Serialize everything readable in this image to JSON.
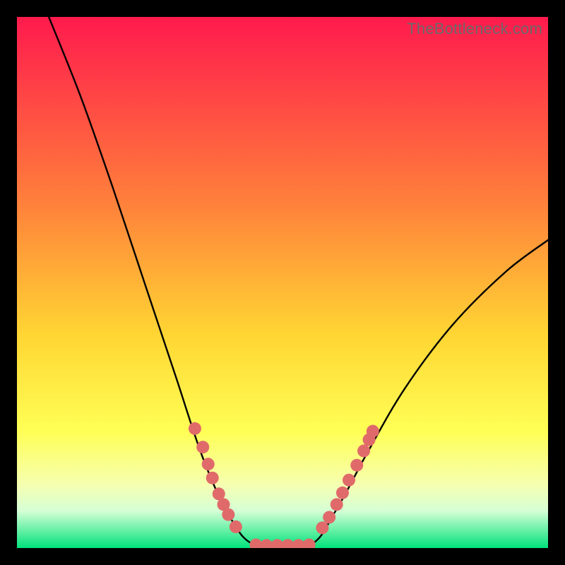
{
  "watermark": "TheBottleneck.com",
  "chart_data": {
    "type": "line",
    "title": "",
    "xlabel": "",
    "ylabel": "",
    "xlim": [
      0,
      100
    ],
    "ylim": [
      0,
      100
    ],
    "gradient_stops": [
      {
        "offset": 0,
        "color": "#ff1a4d"
      },
      {
        "offset": 35,
        "color": "#ff803b"
      },
      {
        "offset": 60,
        "color": "#ffd633"
      },
      {
        "offset": 78,
        "color": "#ffff55"
      },
      {
        "offset": 88,
        "color": "#f6ffb0"
      },
      {
        "offset": 93,
        "color": "#d6ffd6"
      },
      {
        "offset": 100,
        "color": "#00e27a"
      }
    ],
    "curve_left": [
      {
        "x": 6,
        "y": 100
      },
      {
        "x": 12,
        "y": 85
      },
      {
        "x": 18,
        "y": 68
      },
      {
        "x": 24,
        "y": 50
      },
      {
        "x": 30,
        "y": 32
      },
      {
        "x": 35,
        "y": 17
      },
      {
        "x": 40,
        "y": 6
      },
      {
        "x": 45,
        "y": 0.5
      }
    ],
    "curve_flat": [
      {
        "x": 45,
        "y": 0.5
      },
      {
        "x": 55,
        "y": 0.5
      }
    ],
    "curve_right": [
      {
        "x": 55,
        "y": 0.5
      },
      {
        "x": 60,
        "y": 7
      },
      {
        "x": 66,
        "y": 18
      },
      {
        "x": 73,
        "y": 30
      },
      {
        "x": 82,
        "y": 42
      },
      {
        "x": 92,
        "y": 52
      },
      {
        "x": 100,
        "y": 58
      }
    ],
    "dots_left": [
      {
        "x": 33.5,
        "y": 22.5
      },
      {
        "x": 35.0,
        "y": 19.0
      },
      {
        "x": 36.0,
        "y": 15.8
      },
      {
        "x": 36.8,
        "y": 13.2
      },
      {
        "x": 38.0,
        "y": 10.2
      },
      {
        "x": 38.9,
        "y": 8.2
      },
      {
        "x": 39.8,
        "y": 6.3
      },
      {
        "x": 41.2,
        "y": 4.0
      }
    ],
    "dots_flat": [
      {
        "x": 45.0,
        "y": 0.6
      },
      {
        "x": 47.0,
        "y": 0.5
      },
      {
        "x": 49.0,
        "y": 0.5
      },
      {
        "x": 51.0,
        "y": 0.5
      },
      {
        "x": 53.0,
        "y": 0.5
      },
      {
        "x": 55.0,
        "y": 0.6
      }
    ],
    "dots_right": [
      {
        "x": 57.5,
        "y": 3.8
      },
      {
        "x": 58.8,
        "y": 5.8
      },
      {
        "x": 60.2,
        "y": 8.2
      },
      {
        "x": 61.3,
        "y": 10.4
      },
      {
        "x": 62.5,
        "y": 12.8
      },
      {
        "x": 64.0,
        "y": 15.6
      },
      {
        "x": 65.3,
        "y": 18.3
      },
      {
        "x": 66.3,
        "y": 20.4
      },
      {
        "x": 67.0,
        "y": 22.0
      }
    ],
    "dot_color": "#e06a6a",
    "dot_radius": 9
  }
}
